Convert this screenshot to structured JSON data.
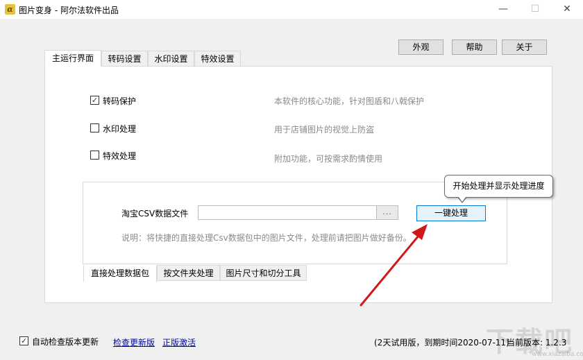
{
  "window": {
    "title": "图片变身 - 阿尔法软件出品",
    "app_icon_glyph": "α",
    "minimize_glyph": "—",
    "maximize_glyph": "☐",
    "close_glyph": "✕"
  },
  "top_buttons": {
    "appearance": "外观",
    "help": "帮助",
    "about": "关于"
  },
  "tabs": [
    {
      "label": "主运行界面",
      "active": true
    },
    {
      "label": "转码设置",
      "active": false
    },
    {
      "label": "水印设置",
      "active": false
    },
    {
      "label": "特效设置",
      "active": false
    }
  ],
  "options": [
    {
      "label": "转码保护",
      "checked": true,
      "desc": "本软件的核心功能，针对图盾和八戟保护"
    },
    {
      "label": "水印处理",
      "checked": false,
      "desc": "用于店铺图片的视觉上防盗"
    },
    {
      "label": "特效处理",
      "checked": false,
      "desc": "附加功能，可按需求酌情使用"
    }
  ],
  "csv": {
    "label": "淘宝CSV数据文件",
    "value": "",
    "browse_label": "...",
    "process_button": "一键处理",
    "tooltip": "开始处理并显示处理进度",
    "note": "说明：将快捷的直接处理Csv数据包中的图片文件，处理前请把图片做好备份。"
  },
  "sub_tabs": [
    {
      "label": "直接处理数据包",
      "active": true
    },
    {
      "label": "按文件夹处理",
      "active": false
    },
    {
      "label": "图片尺寸和切分工具",
      "active": false
    }
  ],
  "footer": {
    "auto_check_label": "自动检查版本更新",
    "auto_check_checked": true,
    "check_update_link": "检查更新版",
    "activate_link": "正版激活",
    "trial_text": "(2天试用版，到期时间2020-07-11)",
    "version_text": "当前版本: 1.2.3"
  },
  "watermark": {
    "text": "下载吧",
    "sub": "www.xiazaiba.com"
  },
  "colors": {
    "accent_border": "#0078d7",
    "link": "#000a96",
    "arrow": "#d01818"
  }
}
